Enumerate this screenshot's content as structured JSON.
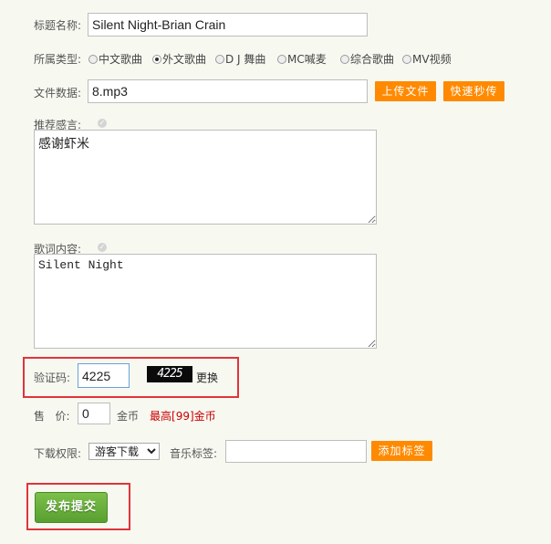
{
  "form": {
    "title_label": "标题名称:",
    "title_value": "Silent Night-Brian Crain",
    "type_label": "所属类型:",
    "types": [
      "中文歌曲",
      "外文歌曲",
      "D J 舞曲",
      "MC喊麦",
      "综合歌曲",
      "MV视频"
    ],
    "type_selected": "外文歌曲",
    "file_label": "文件数据:",
    "file_value": "8.mp3",
    "upload_button": "上传文件",
    "quick_upload_button": "快速秒传",
    "recommend_label": "推荐感言:",
    "recommend_text": "感谢虾米",
    "lyrics_label": "歌词内容:",
    "lyrics_text": "Silent Night",
    "captcha_label": "验证码:",
    "captcha_value": "4225",
    "captcha_image_text": "4225",
    "captcha_refresh": "更换",
    "price_label": "售   价:",
    "price_value": "0",
    "price_unit": "金币",
    "price_max_prefix": "最高",
    "price_max_value": "[99]",
    "price_max_suffix": "金币",
    "download_label": "下载权限:",
    "download_selected": "游客下载",
    "tag_label": "音乐标签:",
    "tag_value": "",
    "add_tag_button": "添加标签",
    "submit_button": "发布提交"
  },
  "colors": {
    "accent": "#ff8a00",
    "submit_green": "#62a836",
    "highlight_red": "#e0343a",
    "price_red": "#cc0000"
  }
}
